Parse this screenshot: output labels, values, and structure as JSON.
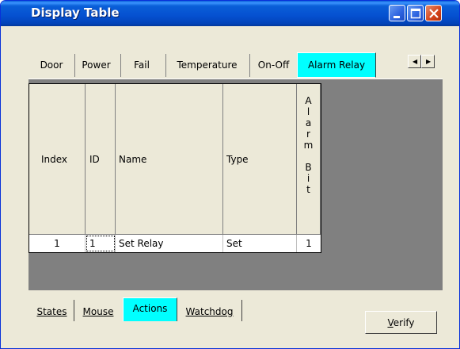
{
  "window": {
    "title": "Display Table"
  },
  "top_tabs": [
    {
      "label": "Door",
      "active": false
    },
    {
      "label": "Power",
      "active": false
    },
    {
      "label": "Fail",
      "active": false
    },
    {
      "label": "Temperature",
      "active": false
    },
    {
      "label": "On-Off",
      "active": false
    },
    {
      "label": "Alarm Relay",
      "active": true
    }
  ],
  "table": {
    "columns": [
      "Index",
      "ID",
      "Name",
      "Type",
      "A l a r m B i t"
    ],
    "rows": [
      {
        "index": "1",
        "id": "1",
        "name": "Set Relay",
        "type": "Set",
        "alarm_bit": "1"
      }
    ]
  },
  "bottom_tabs": [
    {
      "label": "States",
      "active": false
    },
    {
      "label": "Mouse",
      "active": false
    },
    {
      "label": "Actions",
      "active": true
    },
    {
      "label": "Watchdog",
      "active": false
    }
  ],
  "buttons": {
    "verify_prefix": "V",
    "verify_rest": "erify"
  },
  "colors": {
    "active_tab": "#00ffff",
    "grid_bg": "#808080",
    "titlebar": "#0550d0"
  }
}
